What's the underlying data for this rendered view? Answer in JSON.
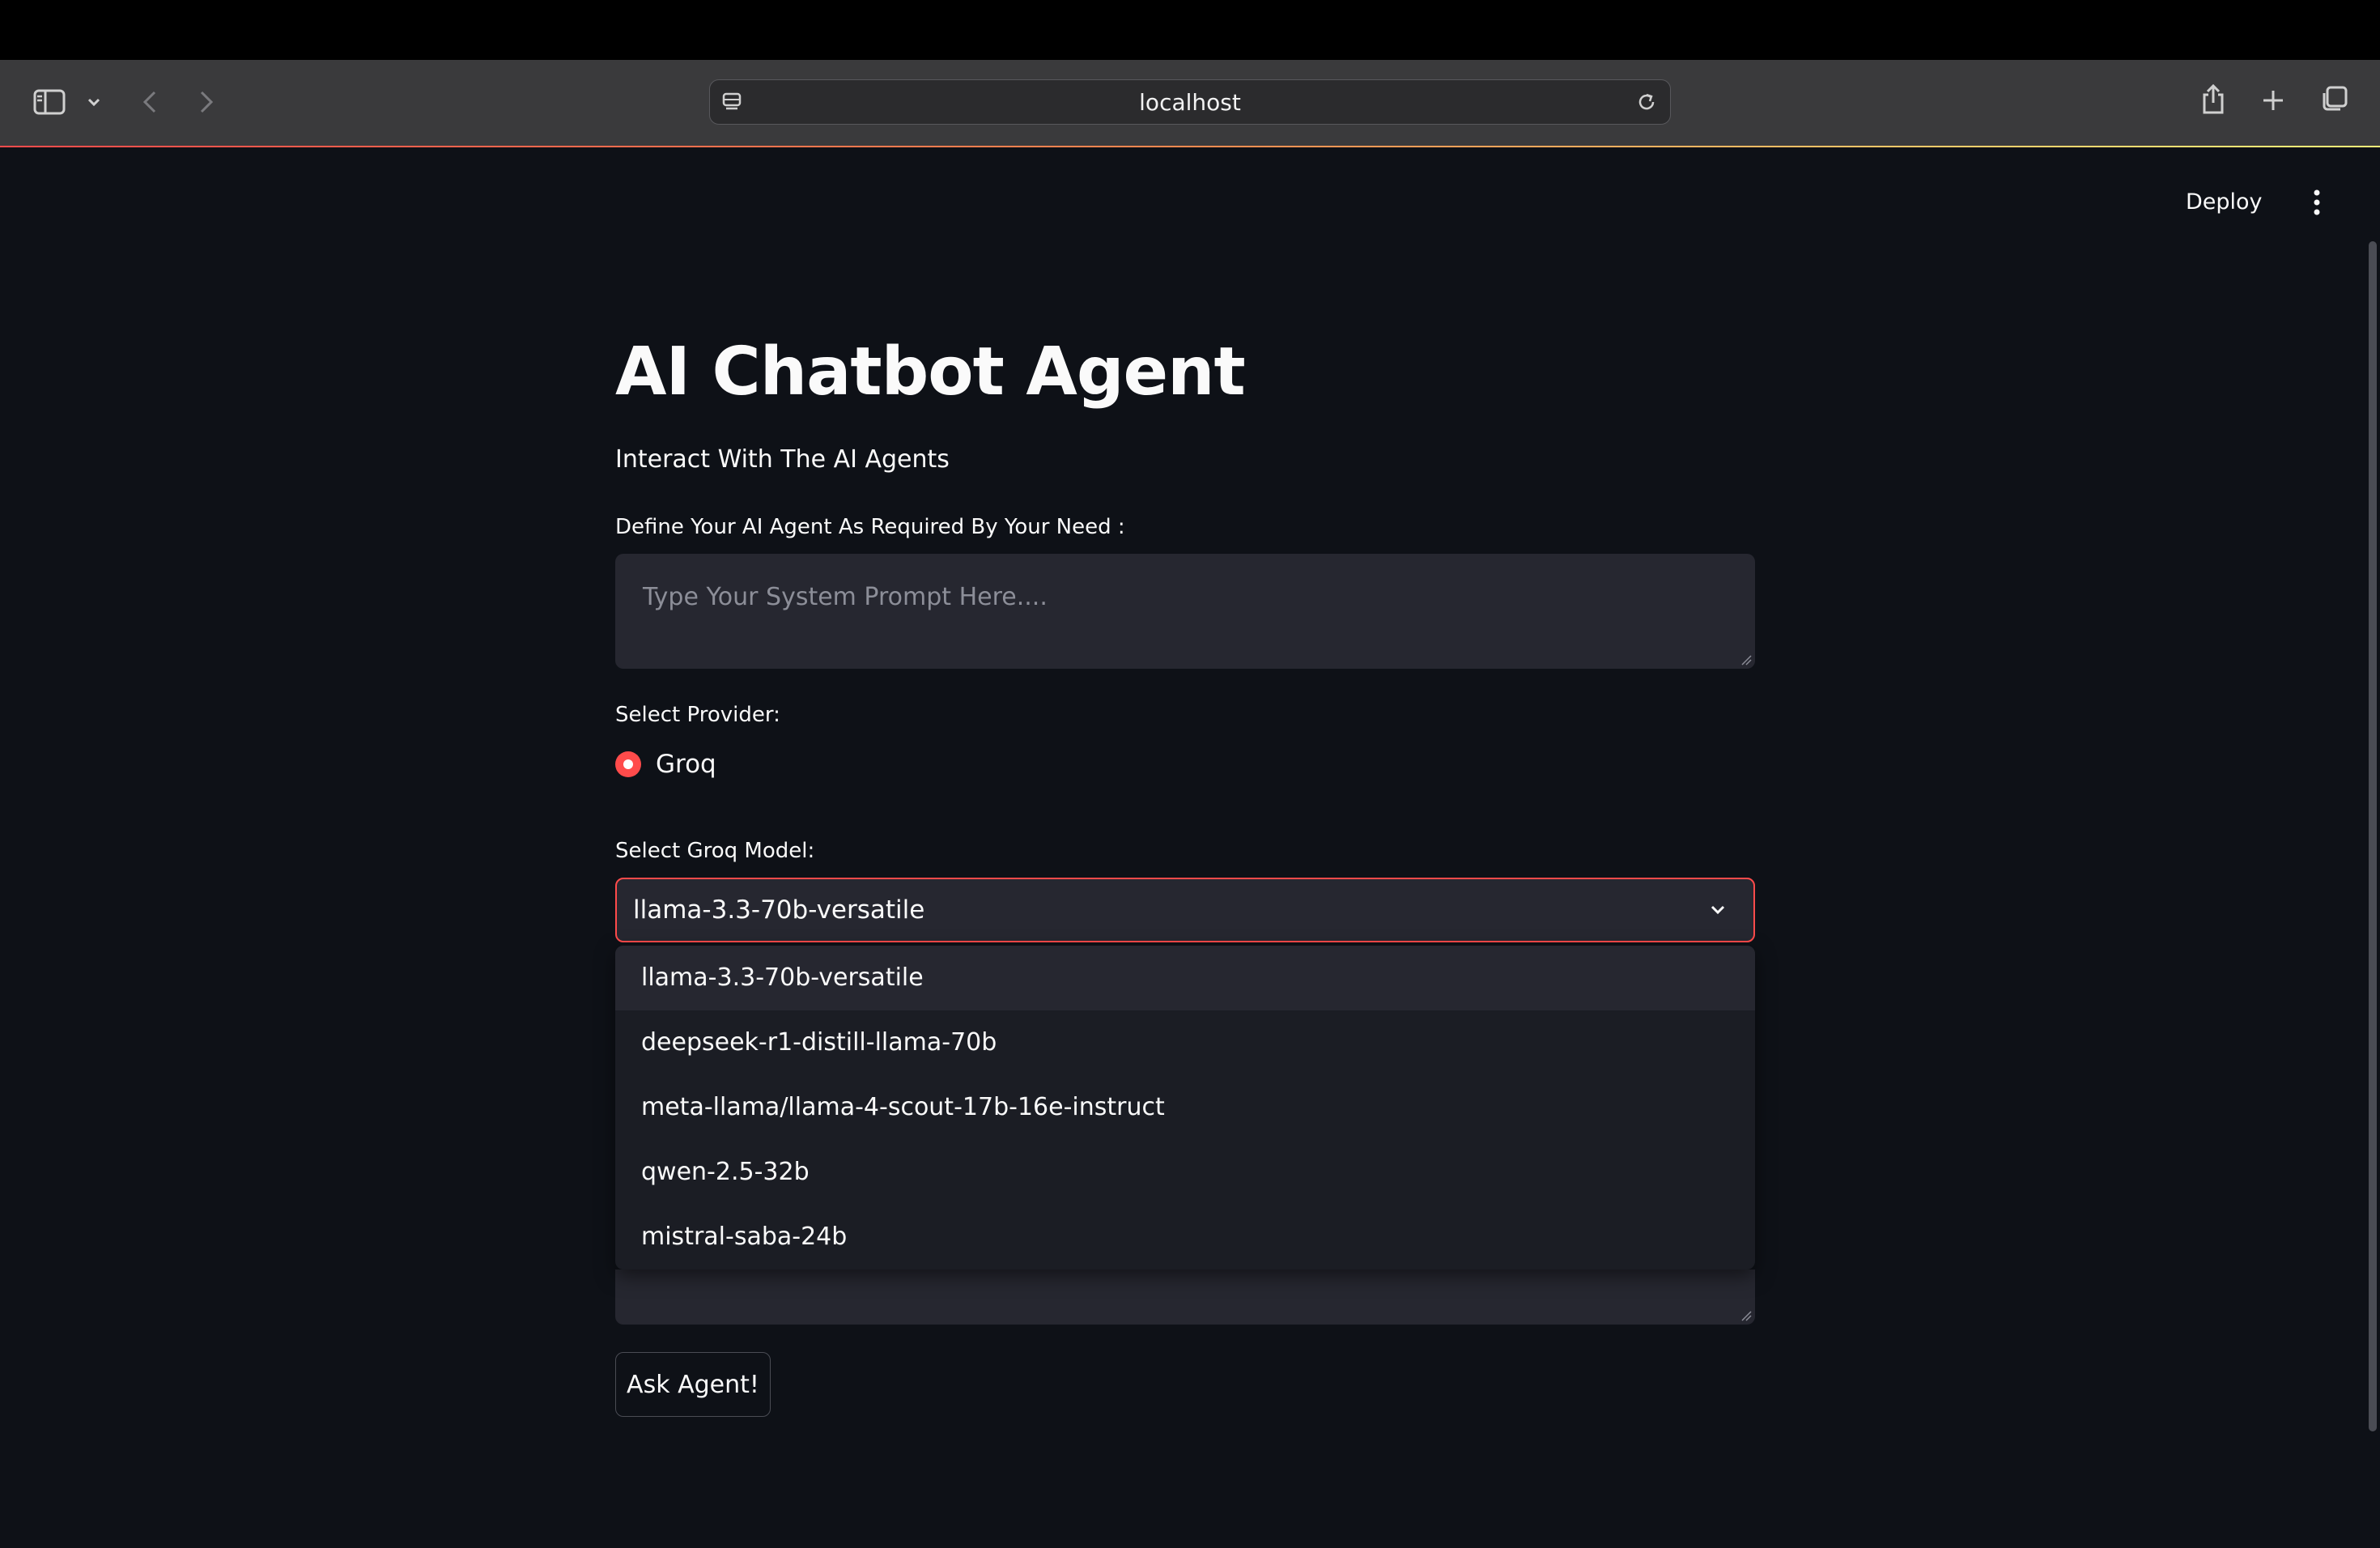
{
  "browser": {
    "url": "localhost"
  },
  "header": {
    "deploy_label": "Deploy"
  },
  "main": {
    "title": "AI Chatbot Agent",
    "subtitle": "Interact With The AI Agents",
    "system_prompt": {
      "label": "Define Your AI Agent As Required By Your Need :",
      "placeholder": "Type Your System Prompt Here....",
      "value": ""
    },
    "provider": {
      "label": "Select Provider:",
      "options": [
        "Groq"
      ],
      "selected": "Groq"
    },
    "model": {
      "label": "Select Groq Model:",
      "selected": "llama-3.3-70b-versatile",
      "options": [
        "llama-3.3-70b-versatile",
        "deepseek-r1-distill-llama-70b",
        "meta-llama/llama-4-scout-17b-16e-instruct",
        "qwen-2.5-32b",
        "mistral-saba-24b"
      ]
    },
    "ask_button_label": "Ask Agent!"
  },
  "icons": {
    "sidebar": "sidebar-icon",
    "chevron_down": "chevron-down-icon",
    "back": "back-arrow-icon",
    "forward": "forward-arrow-icon",
    "site_settings": "page-settings-icon",
    "reload": "reload-icon",
    "share": "share-icon",
    "new_tab": "plus-icon",
    "tabs_overview": "tabs-overview-icon",
    "menu": "kebab-menu-icon"
  },
  "colors": {
    "background": "#0e1117",
    "accent": "#ff4b4b",
    "input_background": "#262730"
  }
}
